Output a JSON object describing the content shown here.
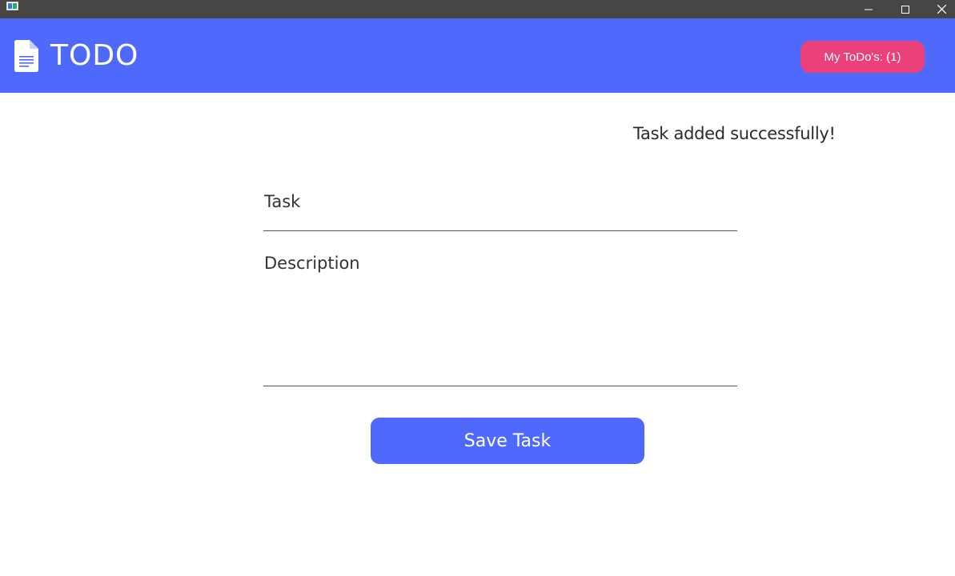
{
  "window": {
    "controls": {
      "minimize_icon": "minimize-icon",
      "maximize_icon": "maximize-icon",
      "close_icon": "close-icon"
    }
  },
  "header": {
    "logo_icon": "document-icon",
    "title": "TODO",
    "my_todos_button": "My ToDo's: (1)",
    "colors": {
      "bar": "#5069fd",
      "button": "#ec407a"
    }
  },
  "main": {
    "status_message": "Task added successfully!",
    "task_field": {
      "placeholder": "Task",
      "value": ""
    },
    "description_field": {
      "placeholder": "Description",
      "value": ""
    },
    "save_button": "Save Task",
    "colors": {
      "accent": "#5069fd"
    }
  }
}
